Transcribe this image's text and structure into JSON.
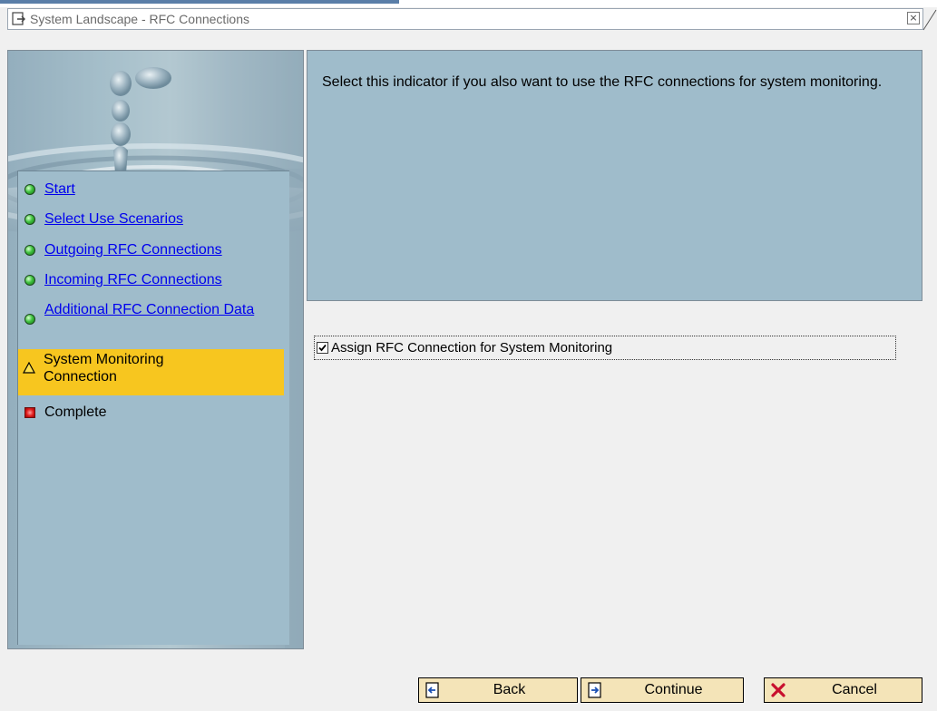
{
  "window": {
    "title": "System Landscape - RFC Connections",
    "close_glyph": "×"
  },
  "wizard": {
    "steps": [
      {
        "label": "Start",
        "status": "done",
        "icon": "green-dot-icon"
      },
      {
        "label": "Select Use Scenarios",
        "status": "done",
        "icon": "green-dot-icon"
      },
      {
        "label": "Outgoing RFC Connections",
        "status": "done",
        "icon": "green-dot-icon"
      },
      {
        "label": "Incoming RFC Connections",
        "status": "done",
        "icon": "green-dot-icon"
      },
      {
        "label": "Additional RFC Connection Data",
        "status": "done",
        "icon": "green-dot-icon"
      },
      {
        "label": "System Monitoring Connection",
        "status": "current",
        "icon": "warning-triangle-icon"
      },
      {
        "label": "Complete",
        "status": "pending",
        "icon": "red-square-icon"
      }
    ]
  },
  "info": {
    "text": "Select this indicator if you also want to use the RFC connections for system monitoring."
  },
  "option": {
    "label": "Assign RFC Connection for System Monitoring",
    "checked": true
  },
  "buttons": {
    "back": "Back",
    "continue": "Continue",
    "cancel": "Cancel"
  },
  "colors": {
    "panel_blue": "#9fbccb",
    "current_step": "#f7c61f",
    "button_bg": "#f4e4b8",
    "link": "#0000ee"
  }
}
